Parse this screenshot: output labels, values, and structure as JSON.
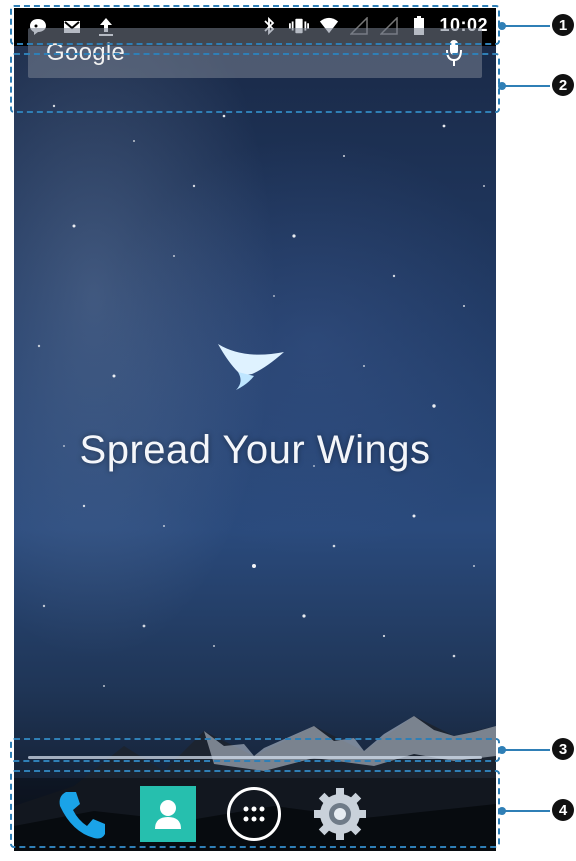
{
  "status_bar": {
    "left_icons": [
      "chat-icon",
      "gmail-icon",
      "upload-icon"
    ],
    "right_icons": [
      "bluetooth-icon",
      "vibrate-icon",
      "wifi-icon",
      "signal-icon",
      "signal-icon",
      "battery-icon"
    ],
    "time": "10:02"
  },
  "search_bar": {
    "label": "Google",
    "icon": "mic-icon"
  },
  "wallpaper": {
    "tagline": "Spread Your Wings",
    "logo": "wings-logo"
  },
  "dock": {
    "items": [
      {
        "name": "phone",
        "icon": "phone-icon"
      },
      {
        "name": "contacts",
        "icon": "contacts-icon"
      },
      {
        "name": "apps",
        "icon": "apps-grid-icon"
      },
      {
        "name": "settings",
        "icon": "settings-icon"
      }
    ]
  },
  "callouts": {
    "c1": "1",
    "c2": "2",
    "c3": "3",
    "c4": "4"
  },
  "colors": {
    "annotation": "#2f7fb6",
    "contacts_tile": "#26bfae",
    "phone_icon": "#1aa3e8"
  }
}
